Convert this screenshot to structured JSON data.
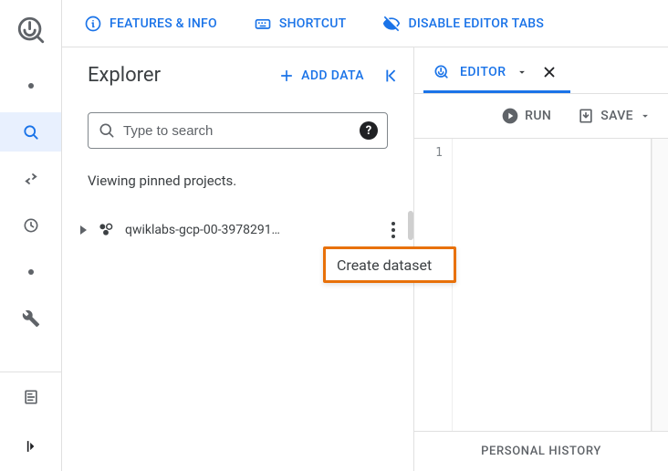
{
  "topbar": {
    "features_label": "FEATURES & INFO",
    "shortcut_label": "SHORTCUT",
    "disable_tabs_label": "DISABLE EDITOR TABS"
  },
  "explorer": {
    "title": "Explorer",
    "add_data_label": "ADD DATA",
    "search_placeholder": "Type to search",
    "pinned_note": "Viewing pinned projects.",
    "project_name": "qwiklabs-gcp-00-3978291…"
  },
  "menu": {
    "create_dataset_label": "Create dataset"
  },
  "editor": {
    "tab_label": "EDITOR",
    "run_label": "RUN",
    "save_label": "SAVE",
    "gutter_lines": [
      "1"
    ],
    "history_label": "PERSONAL HISTORY"
  }
}
